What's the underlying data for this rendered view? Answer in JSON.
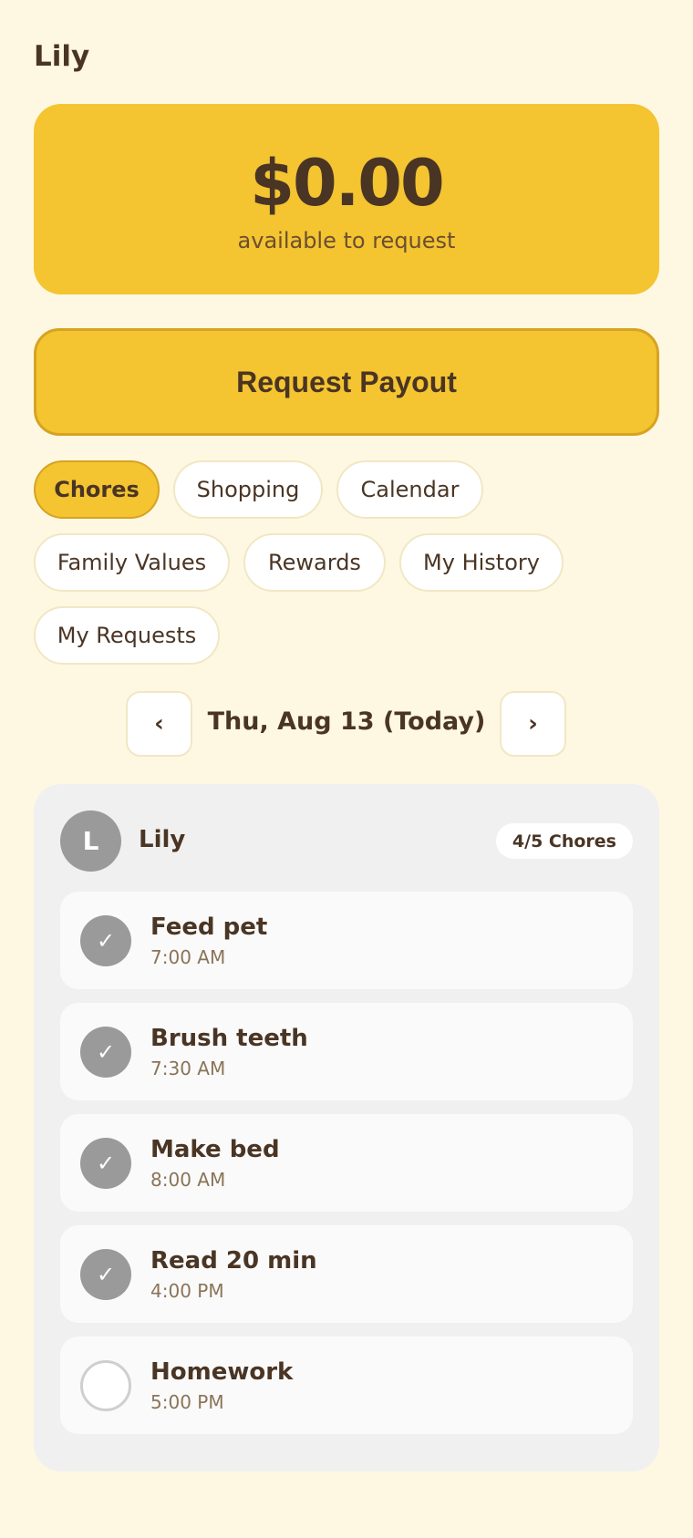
{
  "header": {
    "user_name": "Lily"
  },
  "balance": {
    "amount": "$0.00",
    "caption": "available to request"
  },
  "payout_button": {
    "label": "Request Payout"
  },
  "tabs": [
    {
      "label": "Chores",
      "active": true
    },
    {
      "label": "Shopping",
      "active": false
    },
    {
      "label": "Calendar",
      "active": false
    },
    {
      "label": "Family Values",
      "active": false
    },
    {
      "label": "Rewards",
      "active": false
    },
    {
      "label": "My History",
      "active": false
    },
    {
      "label": "My Requests",
      "active": false
    }
  ],
  "date_nav": {
    "prev_symbol": "‹",
    "next_symbol": "›",
    "date": "Thu, Aug 13 (Today)"
  },
  "chore_panel": {
    "avatar_initial": "L",
    "name": "Lily",
    "count": "4/5 Chores",
    "chores": [
      {
        "title": "Feed pet",
        "time": "7:00 AM",
        "done": true
      },
      {
        "title": "Brush teeth",
        "time": "7:30 AM",
        "done": true
      },
      {
        "title": "Make bed",
        "time": "8:00 AM",
        "done": true
      },
      {
        "title": "Read 20 min",
        "time": "4:00 PM",
        "done": true
      },
      {
        "title": "Homework",
        "time": "5:00 PM",
        "done": false
      }
    ],
    "check_symbol": "✓"
  },
  "colors": {
    "background": "#FEF8E2",
    "accent": "#F4C431",
    "accent_border": "#D6A322",
    "text": "#4A3524",
    "done_check": "#9A9A9A"
  }
}
